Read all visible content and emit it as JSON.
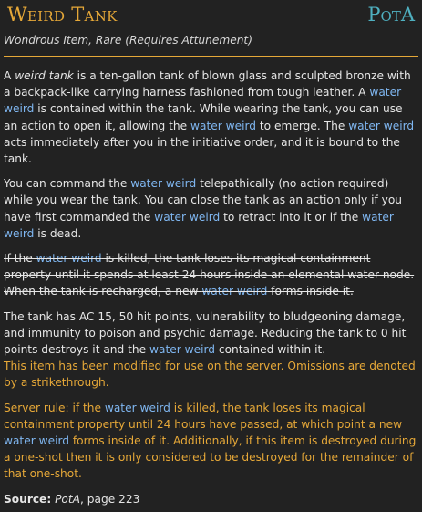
{
  "item": {
    "title": "Weird Tank",
    "source_abbr": "PotA",
    "subtitle": "Wondrous Item, Rare (Requires Attunement)"
  },
  "paragraphs": {
    "p1": {
      "s1": "A ",
      "s2": "weird tank",
      "s3": " is a ten-gallon tank of blown glass and sculpted bronze with a backpack-like carrying harness fashioned from tough leather. A ",
      "l1": "water weird",
      "s4": " is contained within the tank. While wearing the tank, you can use an action to open it, allowing the ",
      "l2": "water weird",
      "s5": " to emerge. The ",
      "l3": "water weird",
      "s6": " acts immediately after you in the initiative order, and it is bound to the tank."
    },
    "p2": {
      "s1": "You can command the ",
      "l1": "water weird",
      "s2": " telepathically (no action required) while you wear the tank. You can close the tank as an action only if you have first commanded the ",
      "l2": "water weird",
      "s3": " to retract into it or if the ",
      "l3": "water weird",
      "s4": " is dead."
    },
    "p3": {
      "s1": "If the ",
      "l1": "water weird",
      "s2": " is killed, the tank loses its magical containment property until it spends at least 24 hours inside an elemental water node. When the tank is recharged, a new ",
      "l2": "water weird",
      "s3": " forms inside it."
    },
    "p4": {
      "s1": "The tank has AC 15, 50 hit points, vulnerability to bludgeoning damage, and immunity to poison and psychic damage. Reducing the tank to 0 hit points destroys it and the ",
      "l1": "water weird",
      "s2": " contained within it."
    },
    "note1": "This item has been modified for use on the server. Omissions are denoted by a strikethrough.",
    "note2": {
      "s1": "Server rule: if the ",
      "l1": "water weird",
      "s2": " is killed, the tank loses its magical containment property until 24 hours have passed, at which point a new ",
      "l2": "water weird",
      "s3": " forms inside of it. Additionally, if this item is destroyed during a one-shot then it is only considered to be destroyed for the remainder of that one-shot."
    }
  },
  "source": {
    "label": "Source:",
    "book": "PotA",
    "page": ", page 223"
  },
  "colors": {
    "background": "#222222",
    "accent": "#e6a838",
    "link": "#7fb6f0",
    "source_abbr": "#4fb0c0"
  }
}
